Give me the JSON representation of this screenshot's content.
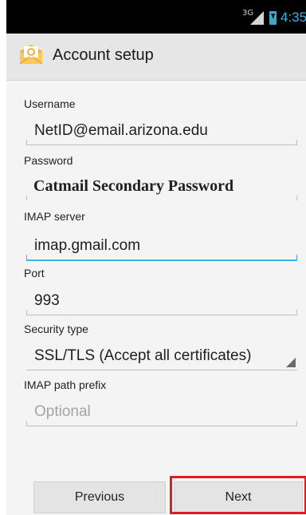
{
  "status_bar": {
    "network": "3G",
    "time": "4:35"
  },
  "action_bar": {
    "icon": "email-app-icon",
    "title": "Account setup"
  },
  "form": {
    "username": {
      "label": "Username",
      "value": "NetID@email.arizona.edu"
    },
    "password": {
      "label": "Password",
      "value": "Catmail Secondary Password"
    },
    "imap_server": {
      "label": "IMAP server",
      "value": "imap.gmail.com"
    },
    "port": {
      "label": "Port",
      "value": "993"
    },
    "security_type": {
      "label": "Security type",
      "value": "SSL/TLS (Accept all certificates)"
    },
    "imap_path_prefix": {
      "label": "IMAP path prefix",
      "value": "",
      "placeholder": "Optional"
    }
  },
  "buttons": {
    "previous": "Previous",
    "next": "Next"
  },
  "colors": {
    "accent": "#33b5e5",
    "highlight": "#e11b22"
  }
}
